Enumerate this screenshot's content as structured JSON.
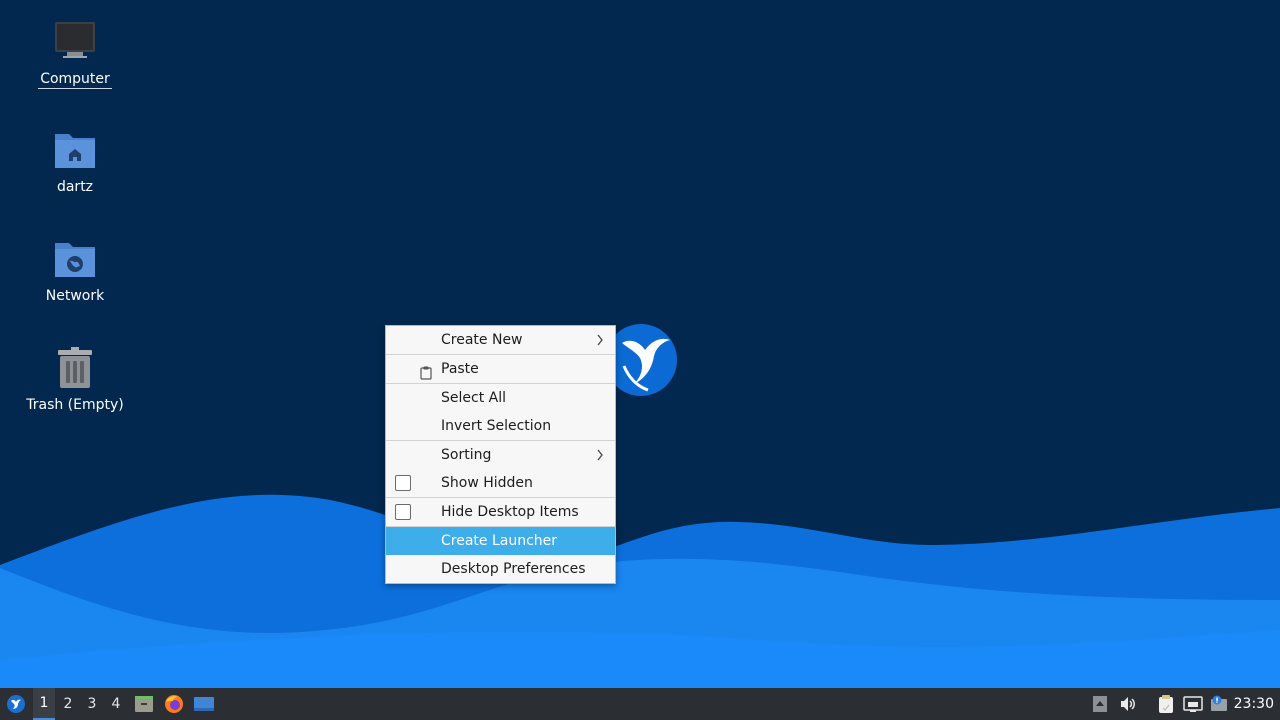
{
  "desktop": {
    "icons": [
      {
        "label": "Computer",
        "icon": "computer-icon"
      },
      {
        "label": "dartz",
        "icon": "home-folder-icon"
      },
      {
        "label": "Network",
        "icon": "network-folder-icon"
      },
      {
        "label": "Trash (Empty)",
        "icon": "trash-icon"
      }
    ]
  },
  "context_menu": {
    "items": [
      {
        "label": "Create New",
        "submenu": true
      },
      {
        "label": "Paste",
        "icon": "clipboard-icon"
      },
      {
        "label": "Select All"
      },
      {
        "label": "Invert Selection"
      },
      {
        "label": "Sorting",
        "submenu": true
      },
      {
        "label": "Show Hidden",
        "checkbox": false
      },
      {
        "label": "Hide Desktop Items",
        "checkbox": false
      },
      {
        "label": "Create Launcher",
        "highlighted": true
      },
      {
        "label": "Desktop Preferences"
      }
    ]
  },
  "taskbar": {
    "workspaces": [
      "1",
      "2",
      "3",
      "4"
    ],
    "active_workspace": "1",
    "launchers": [
      "file-manager-icon",
      "firefox-icon",
      "show-desktop-icon"
    ],
    "tray_icons": [
      "tray-expand-icon",
      "volume-icon",
      "clipboard-manager-icon",
      "network-status-icon",
      "update-notifier-icon"
    ],
    "clock": "23:30"
  },
  "colors": {
    "desktop_background": "#02284f",
    "wave_light": "#1a8cff",
    "wave_dark": "#0a6fe0",
    "menu_highlight": "#3daee9",
    "taskbar": "#2b2e33"
  }
}
